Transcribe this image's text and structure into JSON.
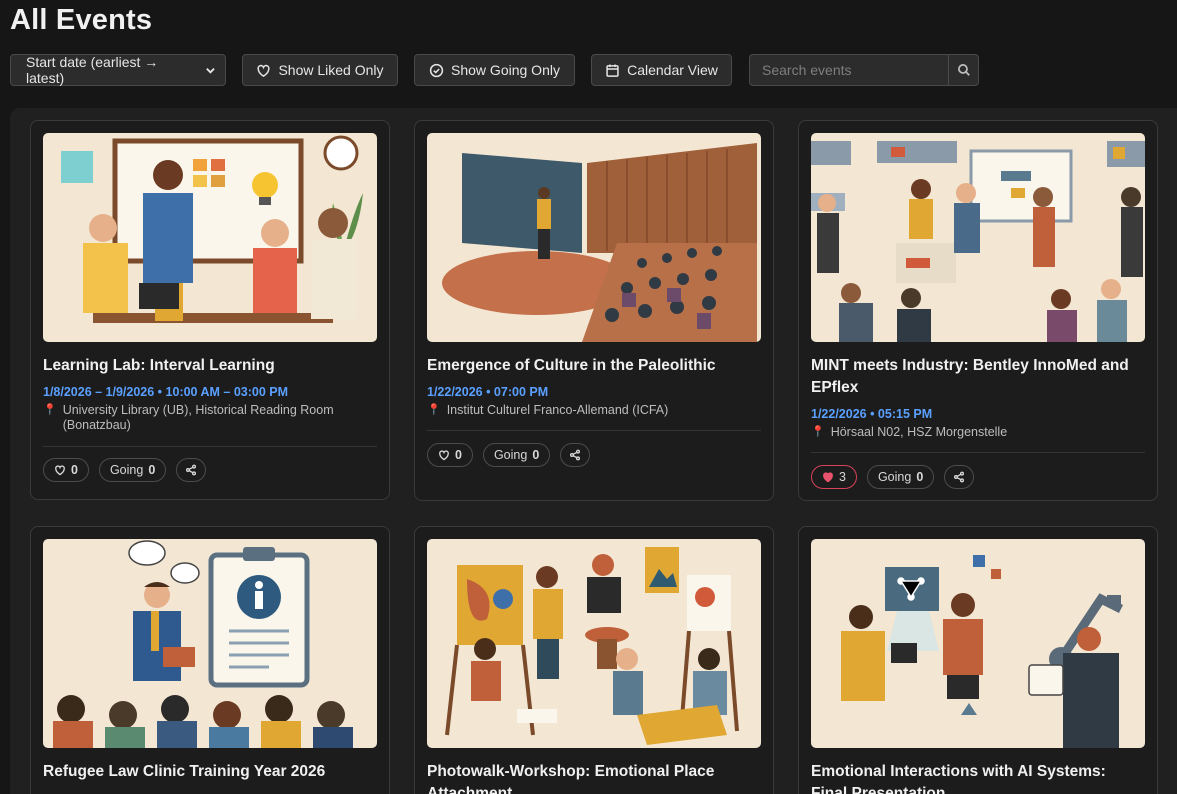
{
  "page": {
    "title": "All Events"
  },
  "toolbar": {
    "sort_value": "Start date (earliest → latest)",
    "liked_label": "Show Liked Only",
    "going_label": "Show Going Only",
    "calendar_label": "Calendar View",
    "search_placeholder": "Search events"
  },
  "events": [
    {
      "title": "Learning Lab: Interval Learning",
      "date": "1/8/2026 – 1/9/2026 • 10:00 AM – 03:00 PM",
      "location": "University Library (UB), Historical Reading Room (Bonatzbau)",
      "likes": "0",
      "going_label": "Going",
      "going": "0"
    },
    {
      "title": "Emergence of Culture in the Paleolithic",
      "date": "1/22/2026 • 07:00 PM",
      "location": "Institut Culturel Franco-Allemand (ICFA)",
      "likes": "0",
      "going_label": "Going",
      "going": "0"
    },
    {
      "title": "MINT meets Industry: Bentley InnoMed and EPflex",
      "date": "1/22/2026 • 05:15 PM",
      "location": "Hörsaal N02, HSZ Morgenstelle",
      "likes": "3",
      "going_label": "Going",
      "going": "0"
    },
    {
      "title": "Refugee Law Clinic Training Year 2026",
      "date": ""
    },
    {
      "title": "Photowalk-Workshop: Emotional Place Attachment",
      "date": ""
    },
    {
      "title": "Emotional Interactions with AI Systems: Final Presentation",
      "date": ""
    }
  ],
  "colors": {
    "accent_blue": "#5aa0ff",
    "liked_red": "#e8536c",
    "background": "#161616"
  }
}
